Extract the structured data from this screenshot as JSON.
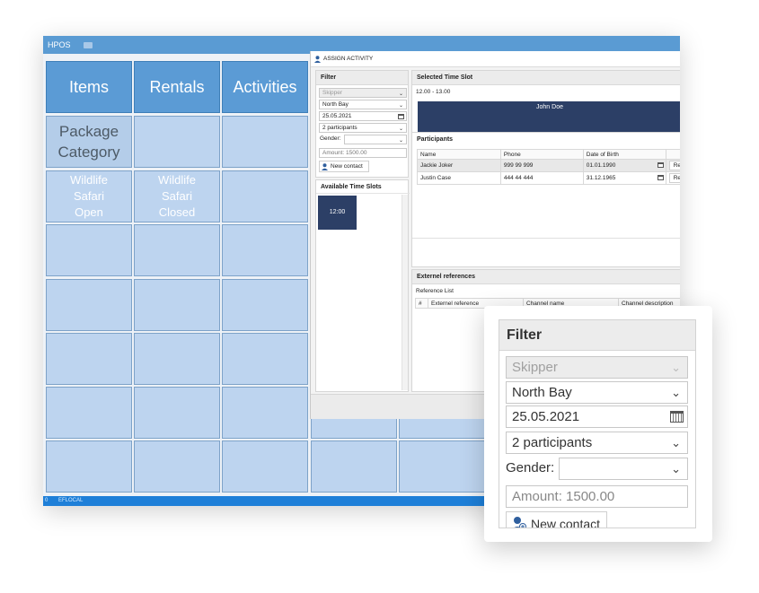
{
  "app": {
    "title": "HPOS",
    "header_tiles": [
      "Items",
      "Rentals",
      "Activities"
    ],
    "category_tile": "Package Category",
    "product_tiles": [
      "Wildlife Safari Open",
      "Wildlife Safari Closed"
    ],
    "status": [
      "0",
      "EFLOCAL"
    ],
    "colors": {
      "header_tile": "#5b9bd5",
      "tile": "#bdd4ef",
      "statusbar": "#1e7fd8"
    }
  },
  "dialog": {
    "title": "ASSIGN ACTIVITY",
    "filter": {
      "heading": "Filter",
      "skipper": "Skipper",
      "location": "North Bay",
      "date": "25.05.2021",
      "participants": "2 participants",
      "gender_label": "Gender:",
      "amount": "Amount: 1500.00",
      "new_contact": "New contact"
    },
    "available_slots": {
      "heading": "Available Time Slots",
      "slots": [
        "12:00"
      ]
    },
    "selected_slot": {
      "heading": "Selected Time Slot",
      "time": "12.00 - 13.00",
      "assignee": "John Doe"
    },
    "participants": {
      "heading": "Participants",
      "columns": [
        "Name",
        "Phone",
        "Date of Birth"
      ],
      "rows": [
        {
          "name": "Jackie Joker",
          "phone": "999 99 999",
          "dob": "01.01.1990",
          "action": "Re"
        },
        {
          "name": "Justin Case",
          "phone": "444 44 444",
          "dob": "31.12.1965",
          "action": "Re"
        }
      ]
    },
    "external_refs": {
      "heading": "Externel references",
      "list_label": "Reference List",
      "columns": [
        "#",
        "Externel reference",
        "Channel name",
        "Channel description"
      ]
    }
  },
  "zoom_filter": {
    "heading": "Filter",
    "skipper": "Skipper",
    "location": "North Bay",
    "date": "25.05.2021",
    "participants": "2 participants",
    "gender_label": "Gender:",
    "amount": "Amount: 1500.00",
    "new_contact": "New contact"
  }
}
